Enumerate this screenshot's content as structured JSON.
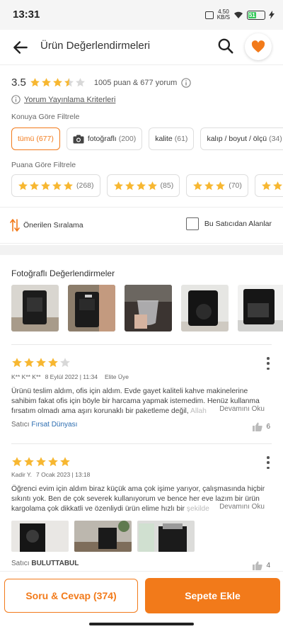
{
  "status_bar": {
    "time": "13:31",
    "speed_value": "4.50",
    "speed_unit": "KB/S",
    "battery": "51"
  },
  "header": {
    "title": "Ürün Değerlendirmeleri"
  },
  "summary": {
    "rating": "3.5",
    "stars_filled": 3.5,
    "count_text": "1005 puan & 677 yorum",
    "criteria_link": "Yorum Yayınlama Kriterleri"
  },
  "topic_filter": {
    "label": "Konuya Göre Filtrele",
    "chips": [
      {
        "label": "tümü",
        "count": "(677)"
      },
      {
        "label": "fotoğraflı",
        "count": "(200)"
      },
      {
        "label": "kalite",
        "count": "(61)"
      },
      {
        "label": "kalıp / boyut / ölçü",
        "count": "(34)"
      }
    ]
  },
  "score_filter": {
    "label": "Puana Göre Filtrele",
    "chips": [
      {
        "stars": 5,
        "count": "(268)"
      },
      {
        "stars": 4,
        "count": "(85)"
      },
      {
        "stars": 3,
        "count": "(70)"
      },
      {
        "stars": 2,
        "count": ""
      }
    ]
  },
  "sort": {
    "label": "Önerilen Sıralama",
    "seller_only_label": "Bu Satıcıdan Alanlar",
    "seller_only_checked": false
  },
  "photos": {
    "title": "Fotoğraflı Değerlendirmeler"
  },
  "reviews": [
    {
      "stars": 4,
      "author": "K** K** K**",
      "date": "8 Eylül 2022 | 11:34",
      "badge": "Elite Üye",
      "text": "Ürünü teslim aldım, ofis için aldım. Evde gayet kaliteli kahve makinelerine sahibim fakat ofis için böyle bir harcama yapmak istemedim. Henüz kullanma fırsatım olmadı ama aşırı korunaklı bir paketleme değil,",
      "text_fade": "Allah",
      "more": "Devamını Oku",
      "seller_label": "Satıcı",
      "seller": "Fırsat Dünyası",
      "likes": "6"
    },
    {
      "stars": 5,
      "author": "Kadir Y.",
      "date": "7 Ocak 2023 | 13:18",
      "badge": "",
      "text": "Öğrenci evim için aldım biraz küçük ama çok işime yarıyor, çalışmasında hiçbir sıkıntı yok. Ben de çok severek kullanıyorum ve bence her eve lazım bir ürün kargolama çok dikkatli ve özenliydi ürün elime hızlı bir",
      "text_fade": "şekilde",
      "more": "Devamını Oku",
      "seller_label": "Satıcı",
      "seller": "BULUTTABUL",
      "likes": "4"
    }
  ],
  "bottom": {
    "qa_label": "Soru & Cevap (374)",
    "cart_label": "Sepete Ekle"
  },
  "colors": {
    "accent": "#f27a1a",
    "star": "#f7b731",
    "link": "#2b6cb0"
  },
  "icons": [
    "back-arrow-icon",
    "search-icon",
    "heart-icon",
    "info-icon",
    "camera-icon",
    "sort-icon",
    "kebab-icon",
    "thumbs-up-icon",
    "star-icon"
  ]
}
